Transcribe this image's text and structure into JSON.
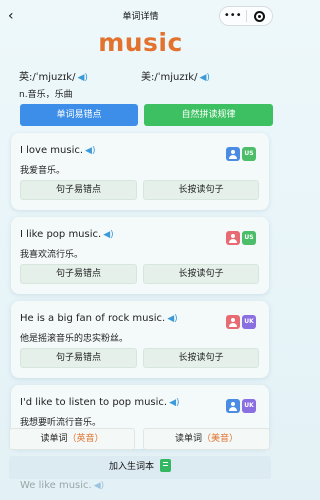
{
  "nav": {
    "back_icon": "‹",
    "title": "单词详情",
    "more_icon": "•••"
  },
  "word": "music",
  "phonetics": {
    "uk": "英:/ˈmjuzɪk/",
    "us": "美:/ˈmjuzɪk/",
    "speaker_icon": "◀)"
  },
  "meaning": "n.音乐，乐曲",
  "top_buttons": {
    "mistakes": "单词易错点",
    "phonics": "自然拼读规律"
  },
  "sentences": [
    {
      "en": "I love music.",
      "cn": "我爱音乐。",
      "voice": "US",
      "gender": "male",
      "mistake_btn": "句子易错点",
      "read_btn": "长按读句子"
    },
    {
      "en": "I like pop music.",
      "cn": "我喜欢流行乐。",
      "voice": "US",
      "gender": "female",
      "mistake_btn": "句子易错点",
      "read_btn": "长按读句子"
    },
    {
      "en": "He is a big fan of rock music.",
      "cn": "他是摇滚音乐的忠实粉丝。",
      "voice": "UK",
      "gender": "female",
      "mistake_btn": "句子易错点",
      "read_btn": "长按读句子"
    },
    {
      "en": "I'd like to listen to pop music.",
      "cn": "我想要听流行音乐。",
      "voice": "UK",
      "gender": "male"
    }
  ],
  "peek_sentence": "We like music.",
  "read_buttons": {
    "uk_prefix": "读单词",
    "uk_accent": "（英音）",
    "us_prefix": "读单词",
    "us_accent": "（美音）"
  },
  "add_vocab": "加入生词本",
  "colors": {
    "accent": "#e2722e",
    "primary_blue": "#3d8ee8",
    "primary_green": "#3cc062"
  }
}
